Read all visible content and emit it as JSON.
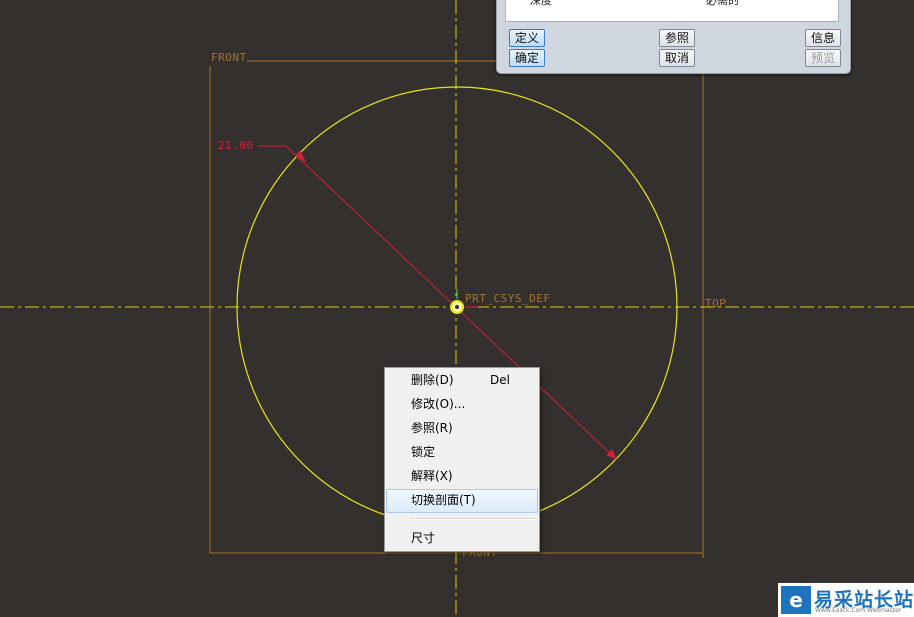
{
  "sketch": {
    "plane_front_label": "FRONT",
    "plane_top_label": "TOP",
    "plane_bottom_label": "FRONT",
    "csys_label": "PRT_CSYS_DEF",
    "dimension_value": "21.00",
    "colors": {
      "background": "#33302d",
      "circle": "#e8e21b",
      "dimension": "#d0203a",
      "datum": "#a8742e",
      "axis": "#e8c41b"
    }
  },
  "dialog": {
    "row_label": "深度",
    "row_value": "必需的",
    "buttons": {
      "define": "定义",
      "references": "参照",
      "info": "信息",
      "ok": "确定",
      "cancel": "取消",
      "preview": "预览"
    }
  },
  "context_menu": {
    "items": [
      {
        "label": "删除(D)",
        "shortcut": "Del"
      },
      {
        "label": "修改(O)...",
        "shortcut": ""
      },
      {
        "label": "参照(R)",
        "shortcut": ""
      },
      {
        "label": "锁定",
        "shortcut": ""
      },
      {
        "label": "解释(X)",
        "shortcut": ""
      },
      {
        "label": "切换剖面(T)",
        "shortcut": ""
      },
      {
        "label": "尺寸",
        "shortcut": ""
      }
    ],
    "highlighted_index": 5
  },
  "watermark": {
    "name": "易采站长站",
    "url": "Www.Easck.Com Webmaster",
    "icon": "e-logo-icon"
  }
}
